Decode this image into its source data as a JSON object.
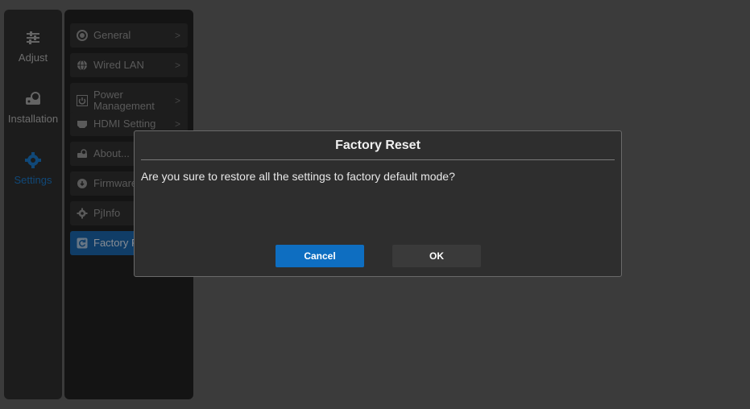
{
  "rail": {
    "items": [
      {
        "label": "Adjust",
        "icon": "sliders-icon"
      },
      {
        "label": "Installation",
        "icon": "projector-icon"
      },
      {
        "label": "Settings",
        "icon": "gear-icon",
        "active": true
      }
    ]
  },
  "submenu": {
    "items": [
      {
        "label": "General",
        "icon": "radio-icon",
        "chevron": ">"
      },
      {
        "label": "Wired LAN",
        "icon": "globe-icon",
        "chevron": ">"
      },
      {
        "label_line1": "Power",
        "label_line2": "Management",
        "icon": "power-icon",
        "chevron": ">"
      },
      {
        "label": "HDMI Setting",
        "icon": "hdmi-icon",
        "chevron": ">"
      },
      {
        "label": "About...",
        "icon": "projector-icon"
      },
      {
        "label": "Firmware",
        "icon": "firmware-icon"
      },
      {
        "label": "PjInfo",
        "icon": "gear-icon"
      },
      {
        "label": "Factory R",
        "icon": "reset-icon",
        "active": true
      }
    ]
  },
  "dialog": {
    "title": "Factory Reset",
    "message": "Are you sure to restore all the settings to factory default mode?",
    "cancel_label": "Cancel",
    "ok_label": "OK"
  },
  "colors": {
    "accent": "#0e6ec1",
    "background": "#5b5b5b",
    "dialog_bg": "#2e2e2e"
  }
}
